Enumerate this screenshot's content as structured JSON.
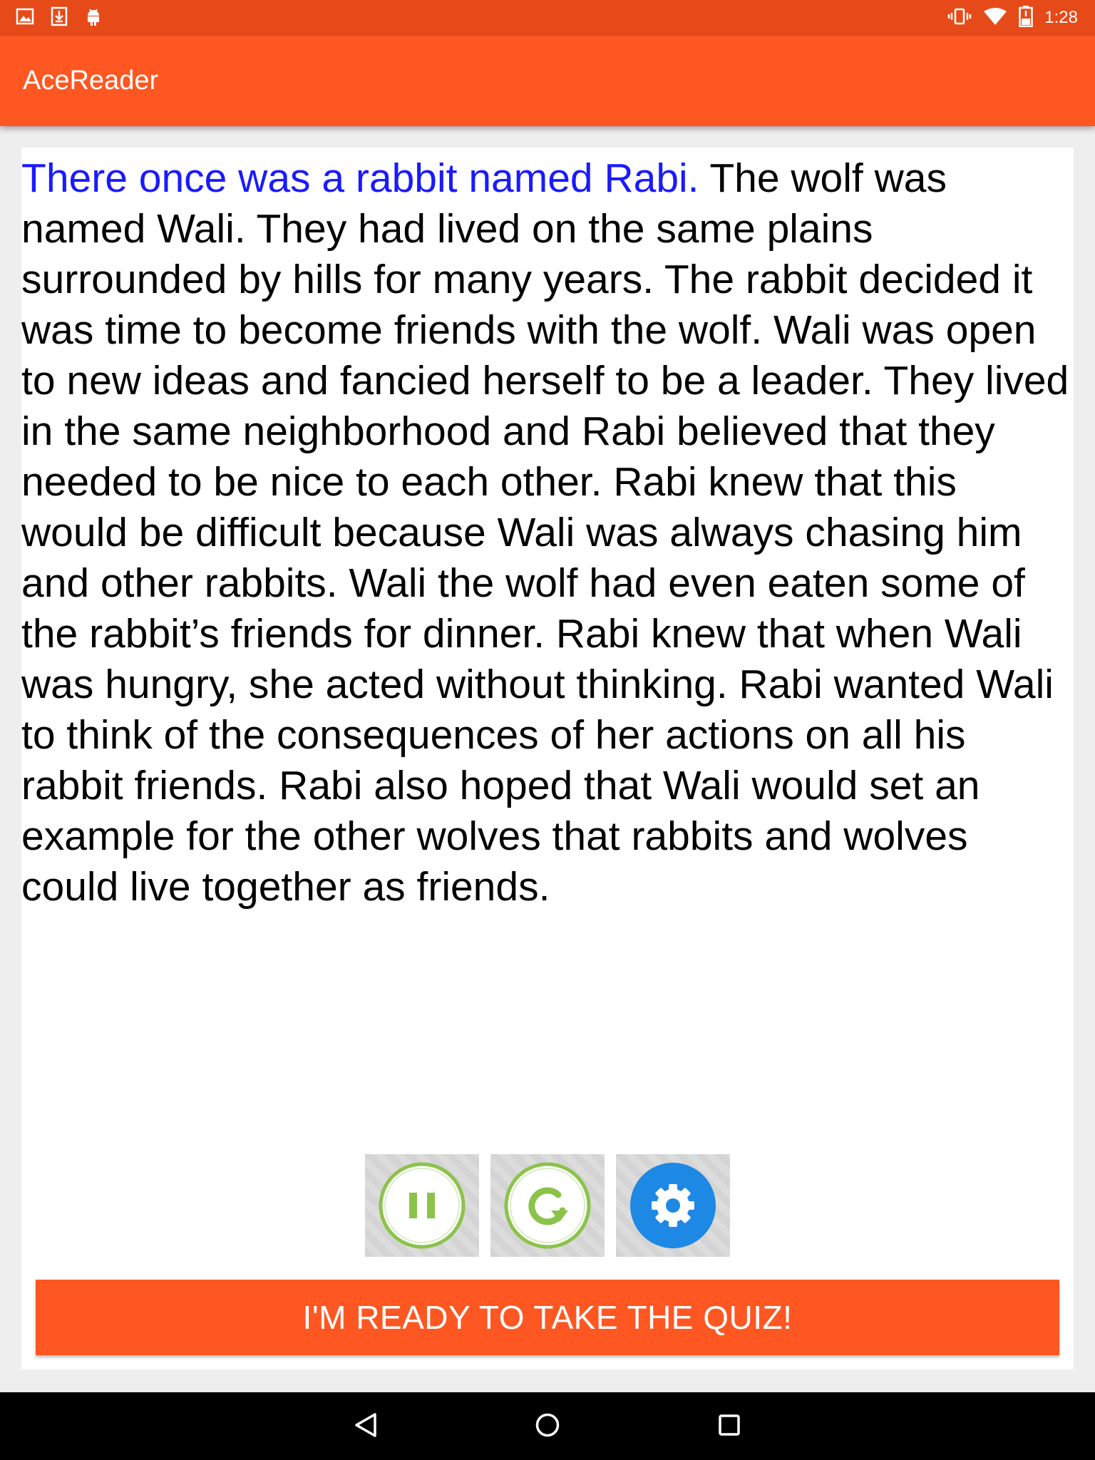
{
  "status_bar": {
    "time": "1:28",
    "left_icons": [
      "image-icon",
      "download-icon",
      "android-icon"
    ],
    "right_icons": [
      "vibrate-icon",
      "wifi-icon",
      "battery-icon"
    ]
  },
  "app_bar": {
    "title": "AceReader"
  },
  "passage": {
    "highlighted": "There once was a rabbit named Rabi.",
    "rest": " The wolf was named Wali. They had lived on the same plains surrounded by hills for many years. The rabbit decided it was time to become friends with the wolf. Wali was open to new ideas and fancied herself to be a leader. They lived in the same neighborhood and Rabi believed that they needed to be nice to each other. Rabi knew that this would be difficult because Wali was always chasing him and other rabbits. Wali the wolf had even eaten some of the rabbit’s friends for dinner. Rabi knew that when Wali was hungry, she acted without thinking. Rabi wanted Wali to think of the consequences of her actions on all his rabbit friends. Rabi also hoped that Wali would set an example for the other wolves that rabbits and wolves could live together as friends."
  },
  "controls": {
    "buttons": [
      {
        "icon": "pause-icon",
        "color": "#8bc34a"
      },
      {
        "icon": "restart-icon",
        "color": "#8bc34a"
      },
      {
        "icon": "settings-icon",
        "color": "#1e88e5"
      }
    ]
  },
  "quiz_button": {
    "label": "I'M READY TO TAKE THE QUIZ!"
  },
  "nav_bar": {
    "icons": [
      "back-icon",
      "home-icon",
      "recents-icon"
    ]
  },
  "colors": {
    "status_bar": "#e64a19",
    "app_bar": "#ff5722",
    "highlight_text": "#1a1aff",
    "quiz_button": "#ff5722"
  }
}
